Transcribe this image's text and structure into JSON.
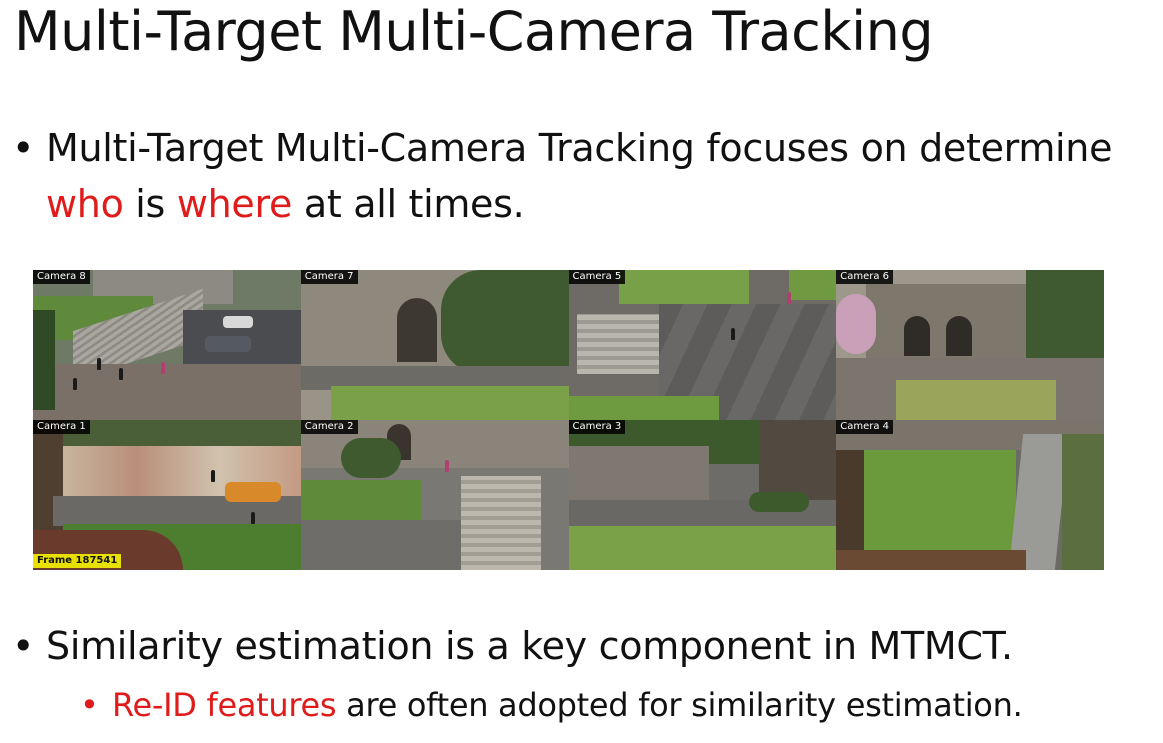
{
  "slide": {
    "title": "Multi-Target Multi-Camera Tracking",
    "bullet1": {
      "prefix": "Multi-Target Multi-Camera Tracking focuses on determine ",
      "who": "who",
      "middle": " is ",
      "where": "where",
      "suffix": " at all times."
    },
    "bullet2": "Similarity estimation is a key component in MTMCT.",
    "sub_bullet": {
      "highlight": "Re-ID features",
      "rest": " are often adopted for similarity estimation."
    },
    "bullet_glyph": "•"
  },
  "cameras": [
    {
      "label": "Camera 8"
    },
    {
      "label": "Camera 7"
    },
    {
      "label": "Camera 5"
    },
    {
      "label": "Camera 6"
    },
    {
      "label": "Camera 1"
    },
    {
      "label": "Camera 2"
    },
    {
      "label": "Camera 3"
    },
    {
      "label": "Camera 4"
    }
  ],
  "frame_label": "Frame 187541",
  "colors": {
    "highlight": "#e01b1b"
  }
}
